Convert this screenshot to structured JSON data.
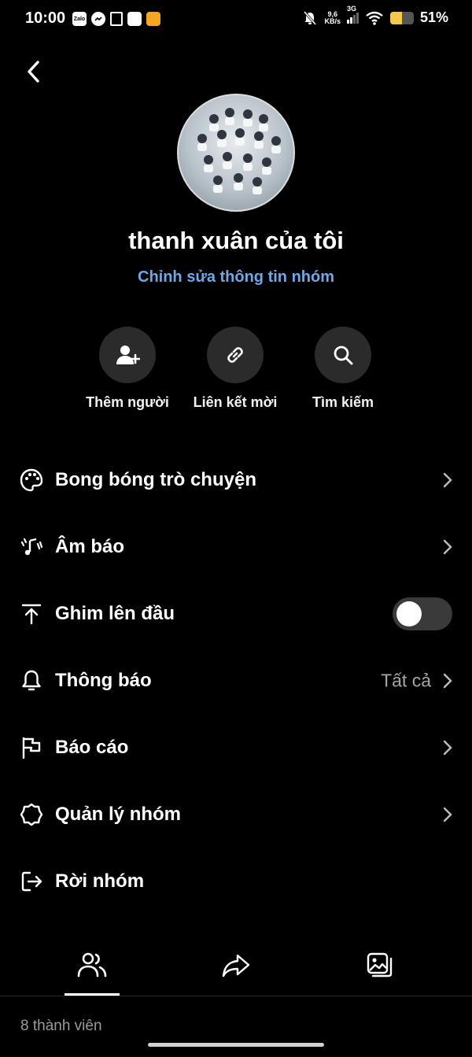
{
  "status_bar": {
    "time": "10:00",
    "app_icons": [
      "Zalo",
      "messenger-icon",
      "note-icon",
      "app-icon",
      "weibo-icon"
    ],
    "net_speed_value": "9,6",
    "net_speed_unit": "KB/s",
    "network": "3G",
    "battery_percent": "51%",
    "battery_level": 0.51
  },
  "group": {
    "name": "thanh xuân của tôi",
    "edit_link": "Chỉnh sửa thông tin nhóm"
  },
  "quick_actions": [
    {
      "label": "Thêm người",
      "icon": "add-person-icon"
    },
    {
      "label": "Liên kết mời",
      "icon": "link-icon"
    },
    {
      "label": "Tìm kiếm",
      "icon": "search-icon"
    }
  ],
  "menu": {
    "chat_bubble": "Bong bóng trò chuyện",
    "sound": "Âm báo",
    "pin": "Ghim lên đầu",
    "pin_enabled": false,
    "notifications": "Thông báo",
    "notifications_value": "Tất cả",
    "report": "Báo cáo",
    "manage": "Quản lý nhóm",
    "leave": "Rời nhóm"
  },
  "tabs": [
    {
      "name": "members",
      "icon": "members-icon",
      "active": true
    },
    {
      "name": "share",
      "icon": "share-icon",
      "active": false
    },
    {
      "name": "media",
      "icon": "media-icon",
      "active": false
    }
  ],
  "members_count_label": "8 thành viên",
  "colors": {
    "background": "#000000",
    "accent_link": "#6fa8e8",
    "secondary_text": "#a6a6a6",
    "circle_bg": "#2b2b2b"
  }
}
